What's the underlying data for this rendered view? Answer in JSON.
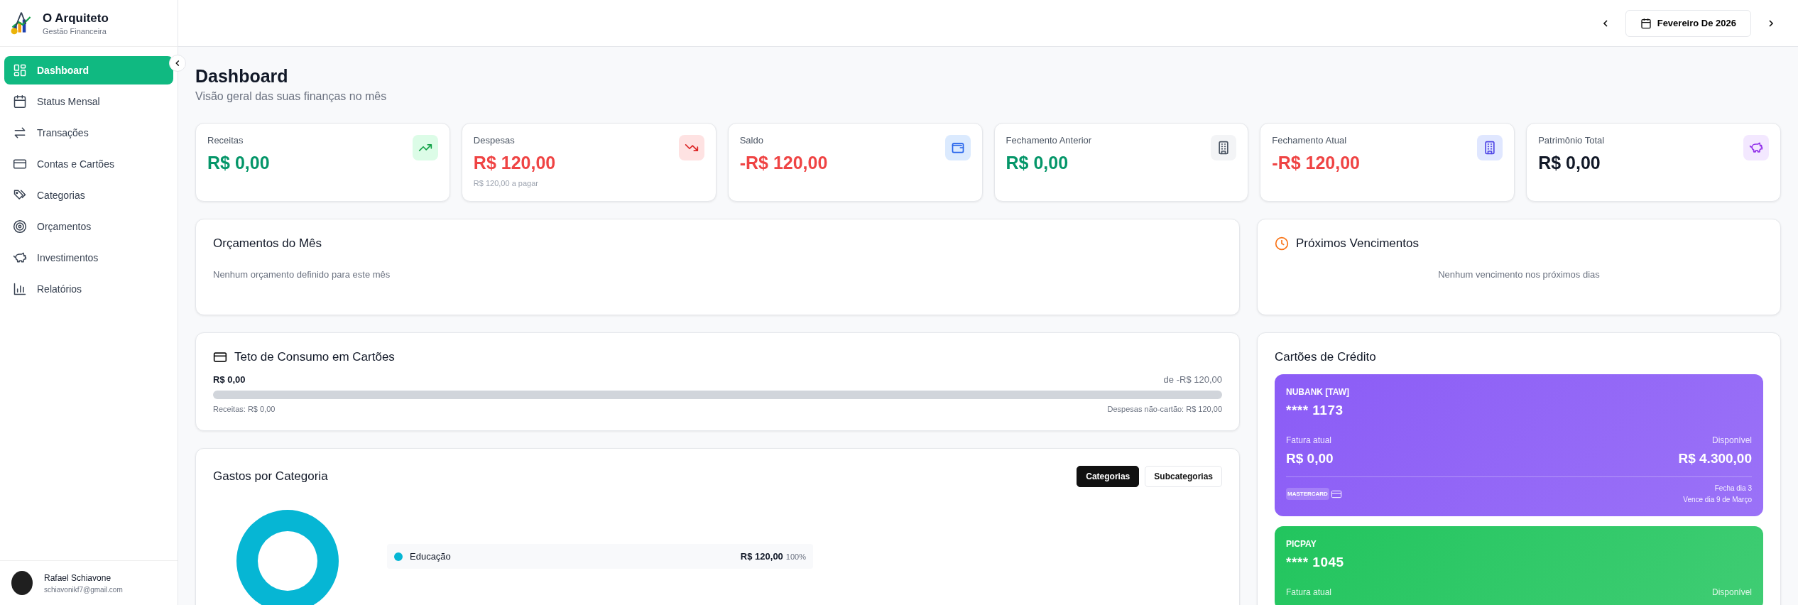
{
  "brand": {
    "title": "O Arquiteto",
    "subtitle": "Gestão Financeira"
  },
  "sidebar": {
    "items": [
      {
        "label": "Dashboard",
        "selected": true
      },
      {
        "label": "Status Mensal",
        "selected": false
      },
      {
        "label": "Transações",
        "selected": false
      },
      {
        "label": "Contas e Cartões",
        "selected": false
      },
      {
        "label": "Categorias",
        "selected": false
      },
      {
        "label": "Orçamentos",
        "selected": false
      },
      {
        "label": "Investimentos",
        "selected": false
      },
      {
        "label": "Relatórios",
        "selected": false
      }
    ]
  },
  "user": {
    "name": "Rafael Schiavone",
    "email": "schiavonikf7@gmail.com"
  },
  "header": {
    "month": "Fevereiro De 2026"
  },
  "page": {
    "title": "Dashboard",
    "subtitle": "Visão geral das suas finanças no mês"
  },
  "summary_cards": [
    {
      "label": "Receitas",
      "value": "R$ 0,00"
    },
    {
      "label": "Despesas",
      "value": "R$ 120,00",
      "sub": "R$ 120,00 a pagar"
    },
    {
      "label": "Saldo",
      "value": "-R$ 120,00"
    },
    {
      "label": "Fechamento Anterior",
      "value": "R$ 0,00"
    },
    {
      "label": "Fechamento Atual",
      "value": "-R$ 120,00"
    },
    {
      "label": "Patrimônio Total",
      "value": "R$ 0,00"
    }
  ],
  "budgets": {
    "title": "Orçamentos do Mês",
    "empty": "Nenhum orçamento definido para este mês"
  },
  "upcoming": {
    "title": "Próximos Vencimentos",
    "empty": "Nenhum vencimento nos próximos dias"
  },
  "card_limit": {
    "title": "Teto de Consumo em Cartões",
    "current": "R$ 0,00",
    "total": "de -R$ 120,00",
    "level": 0,
    "left_note": "Receitas: R$ 0,00",
    "right_note": "Despesas não-cartão: R$ 120,00"
  },
  "spending": {
    "title": "Gastos por Categoria",
    "tabs": [
      {
        "label": "Categorias",
        "selected": true
      },
      {
        "label": "Subcategorias",
        "selected": false
      }
    ],
    "legend": [
      {
        "name": "Educação",
        "color": "#06b6d4",
        "amount": "R$ 120,00",
        "percent": "100%"
      }
    ]
  },
  "credit_cards": {
    "title": "Cartões de Crédito",
    "items": [
      {
        "name": "NUBANK [TAW]",
        "number": "**** 1173",
        "invoice_label": "Fatura atual",
        "invoice": "R$ 0,00",
        "available_label": "Disponível",
        "available": "R$ 4.300,00",
        "brand": "MASTERCARD",
        "closing": "Fecha dia 3",
        "due": "Vence dia 9 de Março",
        "color": "#8b5cf6"
      },
      {
        "name": "PICPAY",
        "number": "**** 1045",
        "invoice_label": "Fatura atual",
        "available_label": "Disponível",
        "color": "#22c55e"
      }
    ]
  }
}
